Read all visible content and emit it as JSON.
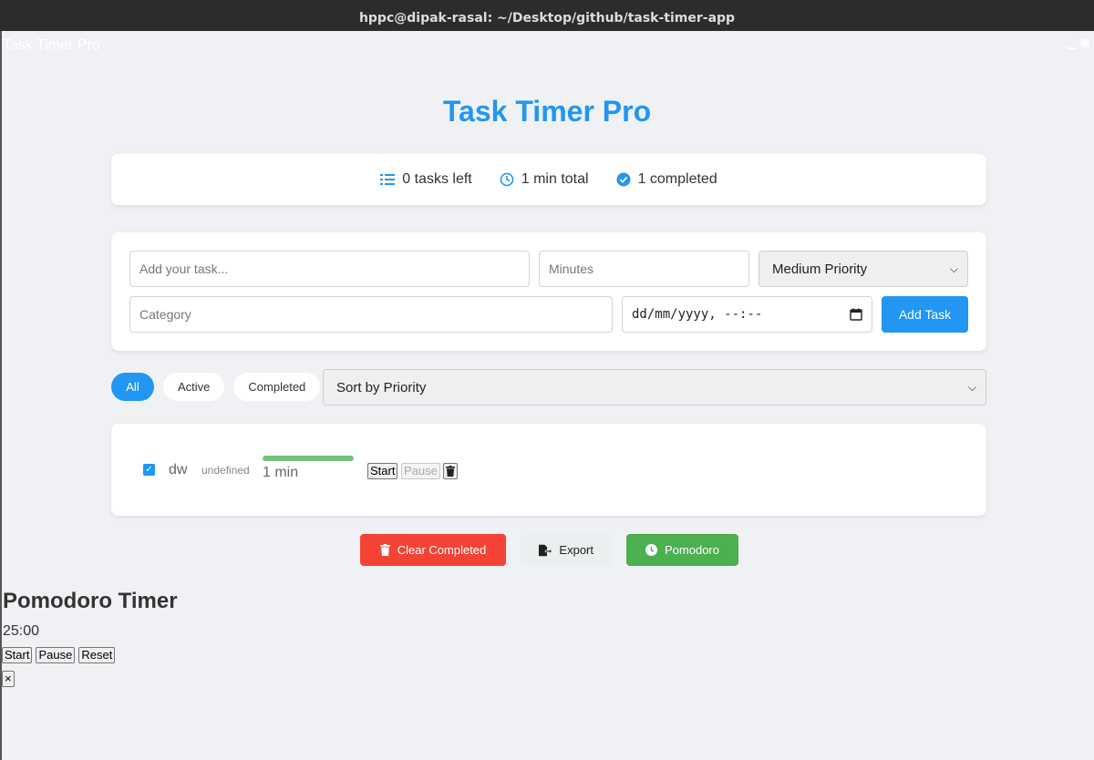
{
  "window": {
    "title": "hppc@dipak-rasal: ~/Desktop/github/task-timer-app",
    "app_name": "Task Timer Pro"
  },
  "header": {
    "title": "Task Timer Pro"
  },
  "stats": {
    "tasks_left": "0 tasks left",
    "total_time": "1 min total",
    "completed": "1 completed"
  },
  "form": {
    "task_placeholder": "Add your task...",
    "minutes_placeholder": "Minutes",
    "priority_selected": "Medium Priority",
    "category_placeholder": "Category",
    "date_placeholder": "dd/mm/yyyy, --:--",
    "add_label": "Add Task"
  },
  "filters": {
    "all": "All",
    "active": "Active",
    "completed": "Completed",
    "sort_selected": "Sort by Priority"
  },
  "tasks": [
    {
      "name": "dw",
      "category": "undefined",
      "time": "1 min",
      "progress": 1.0,
      "completed": true,
      "start_label": "Start",
      "pause_label": "Pause"
    }
  ],
  "actions": {
    "clear": "Clear Completed",
    "export": "Export",
    "pomodoro": "Pomodoro"
  },
  "pomodoro": {
    "title": "Pomodoro Timer",
    "time": "25:00",
    "start": "Start",
    "pause": "Pause",
    "reset": "Reset",
    "close": "×"
  },
  "colors": {
    "accent": "#2196f3",
    "danger": "#f44336",
    "success": "#4caf50",
    "progress": "#77c27b"
  }
}
